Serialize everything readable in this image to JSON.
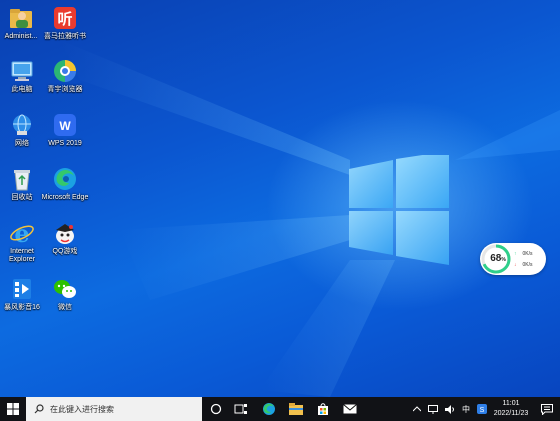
{
  "desktop": {
    "icons": [
      {
        "name": "administrator-folder-icon",
        "label": "Administ..."
      },
      {
        "name": "ximalaya-icon",
        "label": "喜马拉雅听书"
      },
      {
        "name": "this-pc-icon",
        "label": "此电脑"
      },
      {
        "name": "qiyu-browser-icon",
        "label": "青宇浏览器"
      },
      {
        "name": "network-icon",
        "label": "网络"
      },
      {
        "name": "wps-icon",
        "label": "WPS 2019"
      },
      {
        "name": "recycle-bin-icon",
        "label": "回收站"
      },
      {
        "name": "edge-icon",
        "label": "Microsoft Edge"
      },
      {
        "name": "ie-icon",
        "label": "Internet Explorer"
      },
      {
        "name": "qq-game-icon",
        "label": "QQ游戏"
      },
      {
        "name": "baofeng-icon",
        "label": "暴风影音16"
      },
      {
        "name": "wechat-icon",
        "label": "微信"
      }
    ]
  },
  "widget": {
    "percent": "68",
    "percent_sign": "%",
    "upload": "0K/s",
    "download": "0K/s",
    "colors": {
      "ring": "#2fcf8a",
      "up": "#2fcf8a",
      "down": "#e84a4a"
    }
  },
  "taskbar": {
    "search_placeholder": "在此键入进行搜索",
    "clock_time": "11:01",
    "clock_date": "2022/11/23",
    "icons": [
      "windows-start-icon",
      "search-icon",
      "cortana-icon",
      "task-view-icon",
      "edge-icon",
      "file-explorer-icon",
      "store-icon",
      "mail-icon",
      "tray-chevron-icon",
      "network-tray-icon",
      "volume-icon",
      "ime-icon",
      "input-method-icon",
      "notification-icon"
    ],
    "ime_label": "中"
  }
}
